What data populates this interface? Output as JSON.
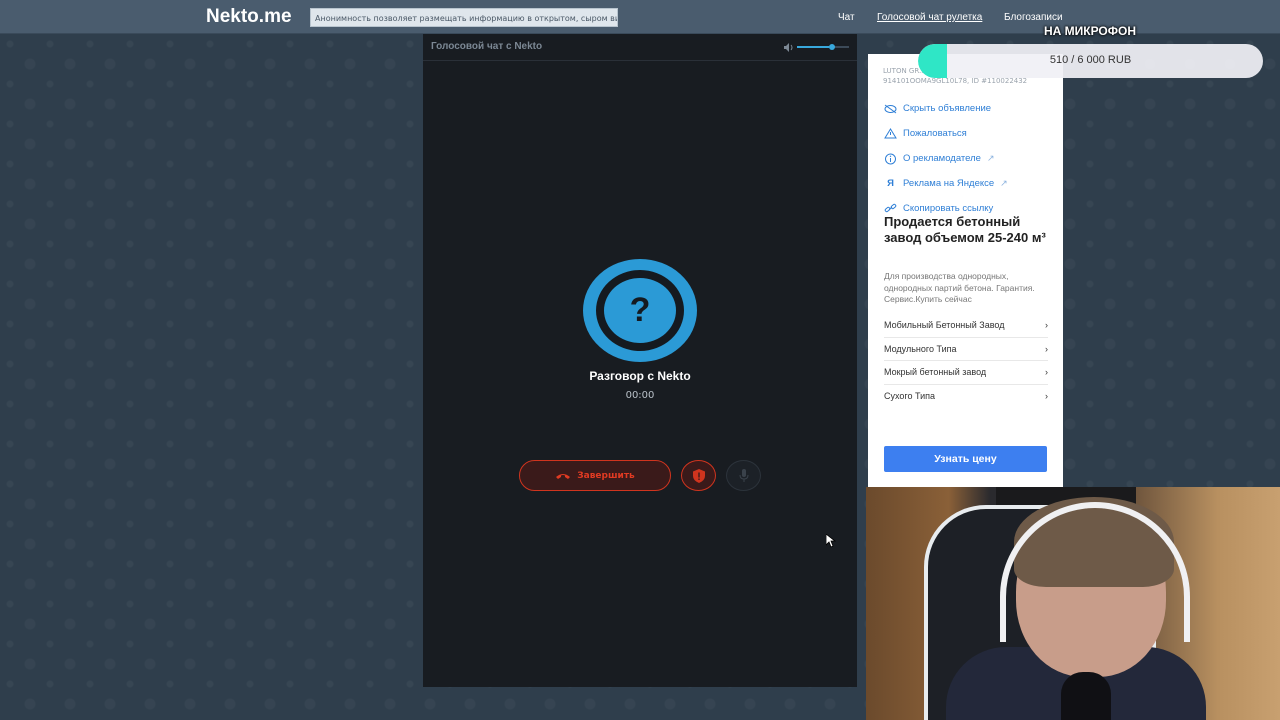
{
  "header": {
    "logo": "Nekto.me",
    "notice": "Анонимность позволяет размещать информацию в открытом, сыром виде!",
    "nav": [
      "Чат",
      "Голосовой чат рулетка",
      "Блогозаписи"
    ]
  },
  "chat": {
    "title": "Голосовой чат с Nekto",
    "volume": 0.62,
    "avatar_glyph": "?",
    "call_title": "Разговор с Nekto",
    "timer": "00:00",
    "end_label": "Завершить"
  },
  "ad": {
    "top_line1": "LUTON GR...",
    "top_line2": "914101OOMA9GL10L78, ID #110022432",
    "menu": [
      {
        "icon": "eye-off-icon",
        "label": "Скрыть объявление"
      },
      {
        "icon": "warning-icon",
        "label": "Пожаловаться"
      },
      {
        "icon": "info-icon",
        "label": "О рекламодателе",
        "ext": "↗"
      },
      {
        "icon": "yandex-icon",
        "label": "Реклама на Яндексе",
        "ext": "↗"
      },
      {
        "icon": "link-icon",
        "label": "Скопировать ссылку"
      }
    ],
    "title": "Продается бетонный завод объемом 25-240 м³",
    "description": "Для производства однородных, однородных партий бетона. Гарантия. Сервис.Купить сейчас",
    "links": [
      "Мобильный Бетонный Завод",
      "Модульного Типа",
      "Мокрый бетонный завод",
      "Сухого Типа"
    ],
    "link_arrow": "›",
    "cta": "Узнать цену"
  },
  "donation": {
    "title": "НА МИКРОФОН",
    "progress_text": "510 / 6 000 RUB",
    "progress": 0.085,
    "accent": "#2fe6c6"
  },
  "colors": {
    "danger": "#d0341e",
    "brand_blue": "#2b9ad6",
    "cta_blue": "#3d7ff0"
  }
}
